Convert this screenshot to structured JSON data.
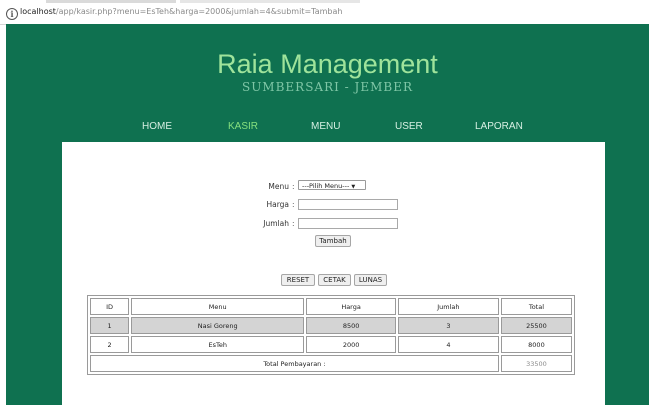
{
  "browser": {
    "url_host": "localhost",
    "url_path": "/app/kasir.php?menu=EsTeh&harga=2000&jumlah=4&submit=Tambah"
  },
  "header": {
    "title": "Raia Management",
    "subtitle": "SUMBERSARI - JEMBER"
  },
  "nav": {
    "items": [
      {
        "label": "HOME"
      },
      {
        "label": "KASIR",
        "active": true
      },
      {
        "label": "MENU"
      },
      {
        "label": "USER"
      },
      {
        "label": "LAPORAN"
      }
    ]
  },
  "form": {
    "menu_label": "Menu",
    "menu_selected": "---Pilih Menu---",
    "harga_label": "Harga",
    "harga_value": "",
    "jumlah_label": "Jumlah",
    "jumlah_value": "",
    "submit_label": "Tambah"
  },
  "actions": {
    "reset_label": "RESET",
    "cetak_label": "CETAK",
    "lunas_label": "LUNAS"
  },
  "table": {
    "headers": [
      "ID",
      "Menu",
      "Harga",
      "Jumlah",
      "Total"
    ],
    "rows": [
      [
        "1",
        "Nasi Goreng",
        "8500",
        "3",
        "25500"
      ],
      [
        "2",
        "EsTeh",
        "2000",
        "4",
        "8000"
      ]
    ],
    "total_label": "Total Pembayaran :",
    "total_value": "33500"
  },
  "colors": {
    "page_bg": "#0f7150",
    "title": "#9fe39b",
    "nav_active": "#86e07e",
    "row_shade": "#d4d4d4"
  }
}
